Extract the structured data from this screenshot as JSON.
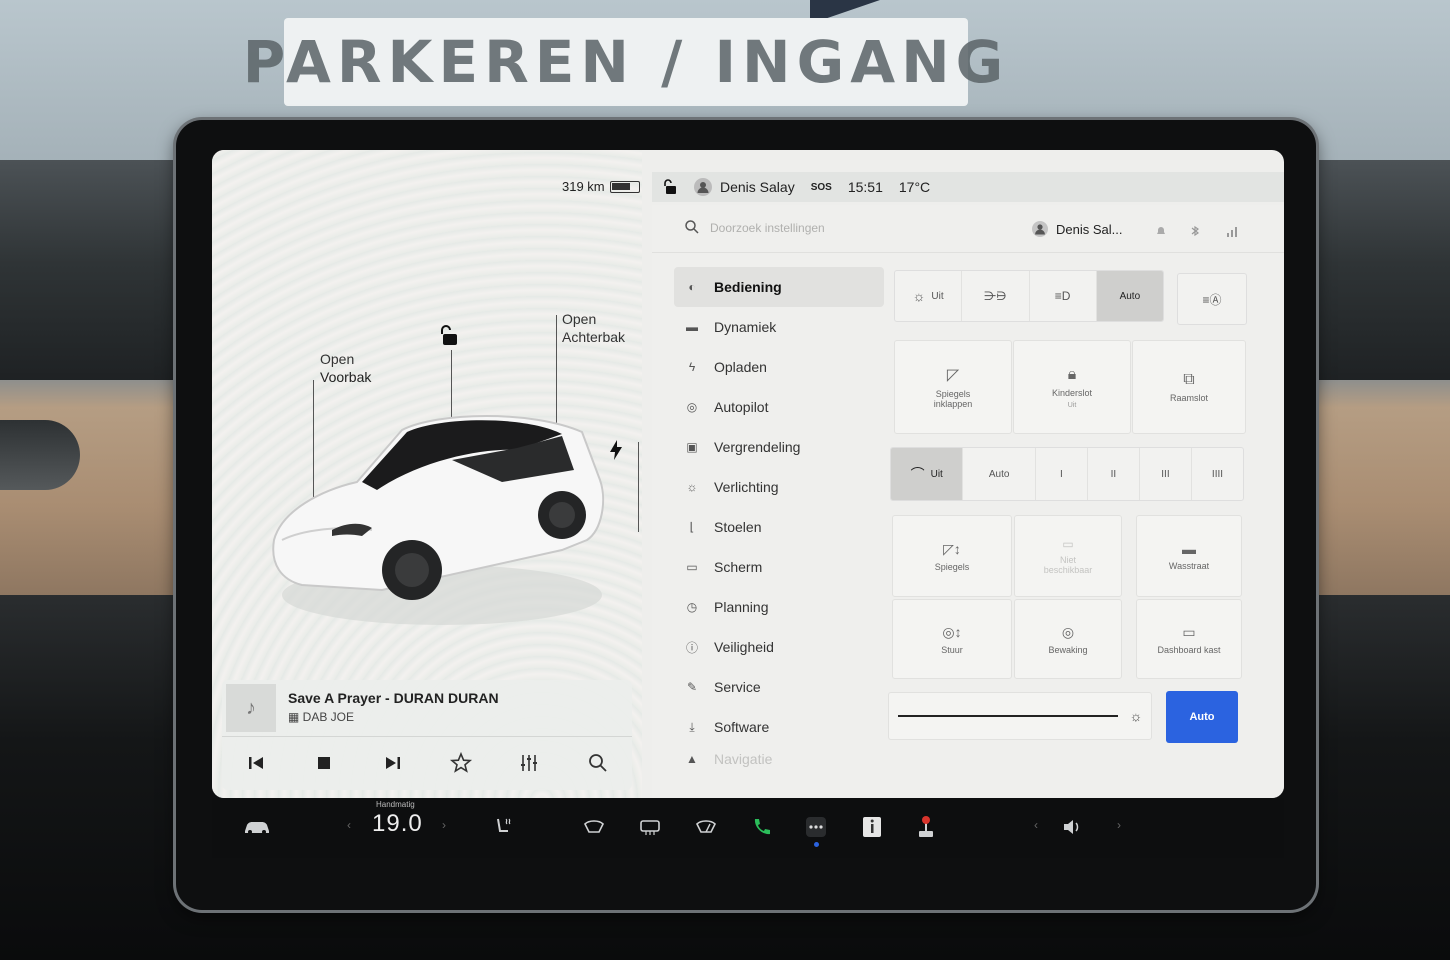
{
  "scene": {
    "sign_text": "PARKEREN / INGANG"
  },
  "car_panel": {
    "range": "319 km",
    "frunk": {
      "state": "Open",
      "label": "Voorbak"
    },
    "trunk": {
      "state": "Open",
      "label": "Achterbak"
    },
    "icons": {
      "lock": "unlock-icon",
      "charge": "lightning-icon"
    }
  },
  "media": {
    "track": "Save A Prayer - DURAN DURAN",
    "source": "DAB JOE",
    "controls": [
      "previous-icon",
      "stop-icon",
      "next-icon",
      "star-icon",
      "equalizer-icon",
      "search-icon"
    ]
  },
  "status": {
    "user": "Denis Salay",
    "sos": "SOS",
    "time": "15:51",
    "temperature": "17°C"
  },
  "settings": {
    "search_placeholder": "Doorzoek instellingen",
    "profile_name": "Denis Sal...",
    "nav": [
      {
        "label": "Bediening",
        "icon": "toggle-icon",
        "active": true
      },
      {
        "label": "Dynamiek",
        "icon": "car-icon"
      },
      {
        "label": "Opladen",
        "icon": "lightning-icon"
      },
      {
        "label": "Autopilot",
        "icon": "steering-wheel-icon"
      },
      {
        "label": "Vergrendeling",
        "icon": "lock-icon"
      },
      {
        "label": "Verlichting",
        "icon": "light-icon"
      },
      {
        "label": "Stoelen",
        "icon": "seat-icon"
      },
      {
        "label": "Scherm",
        "icon": "display-icon"
      },
      {
        "label": "Planning",
        "icon": "clock-icon"
      },
      {
        "label": "Veiligheid",
        "icon": "info-icon"
      },
      {
        "label": "Service",
        "icon": "wrench-icon"
      },
      {
        "label": "Software",
        "icon": "download-icon"
      },
      {
        "label": "Navigatie",
        "icon": "navigation-icon"
      }
    ],
    "lights": {
      "options": [
        "Uit",
        "",
        "",
        "Auto"
      ],
      "selected": "Auto"
    },
    "quick_cards": [
      {
        "label": "Spiegels inklappen",
        "sub": ""
      },
      {
        "label": "Kinderslot",
        "sub": "Uit"
      },
      {
        "label": "Raamslot",
        "sub": ""
      }
    ],
    "wipers": {
      "options": [
        "Uit",
        "Auto",
        "I",
        "II",
        "III",
        "IIII"
      ],
      "selected": "Uit"
    },
    "adjust_cards": [
      {
        "label": "Spiegels",
        "disabled": false
      },
      {
        "label": "Niet beschikbaar",
        "disabled": true
      },
      {
        "label": "Wasstraat",
        "disabled": false
      },
      {
        "label": "Stuur",
        "disabled": false
      },
      {
        "label": "Bewaking",
        "disabled": false
      },
      {
        "label": "Dashboard kast",
        "disabled": false
      }
    ],
    "brightness_auto": "Auto"
  },
  "bottom_bar": {
    "temp_mode": "Handmatig",
    "temp_value": "19.0"
  },
  "colors": {
    "accent": "#2b63e0",
    "phone_green": "#2bbd5a",
    "joystick_red": "#d8342c"
  }
}
